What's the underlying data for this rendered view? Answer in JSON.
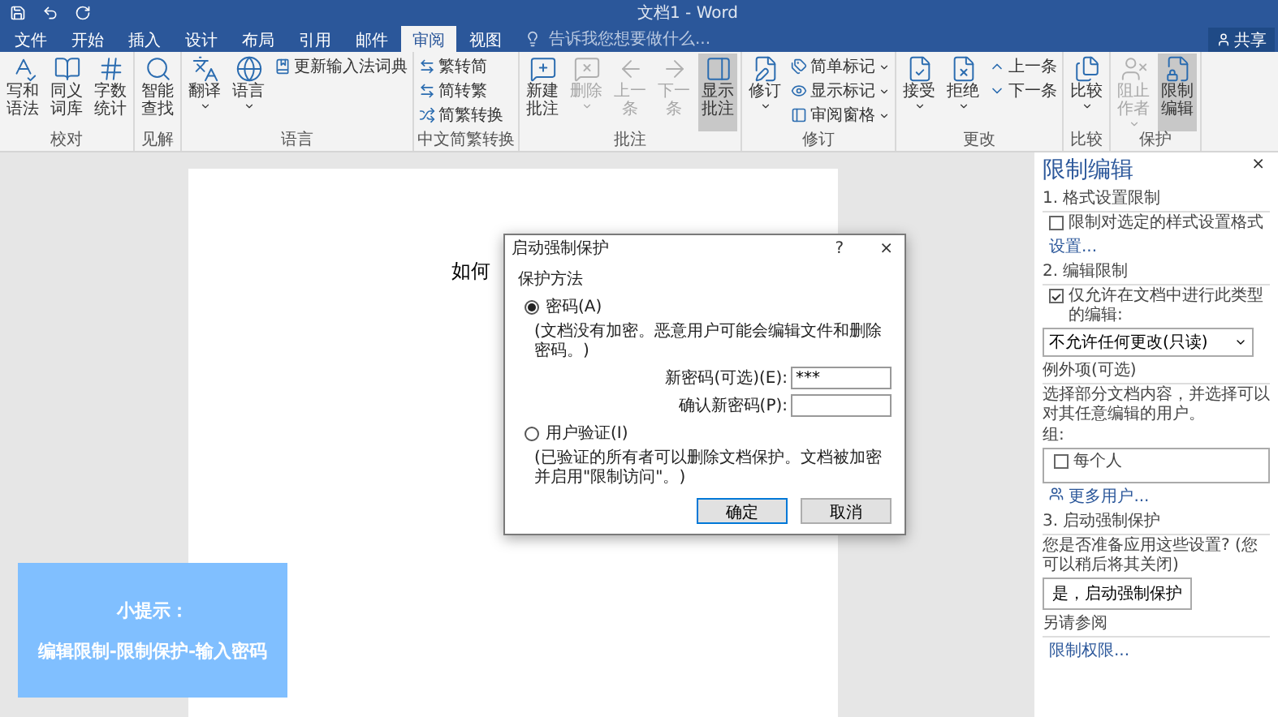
{
  "window": {
    "title": "文档1 - Word",
    "share": "共享"
  },
  "tabs": [
    {
      "label": "文件",
      "selected": false
    },
    {
      "label": "开始",
      "selected": false
    },
    {
      "label": "插入",
      "selected": false
    },
    {
      "label": "设计",
      "selected": false
    },
    {
      "label": "布局",
      "selected": false
    },
    {
      "label": "引用",
      "selected": false
    },
    {
      "label": "邮件",
      "selected": false
    },
    {
      "label": "审阅",
      "selected": true
    },
    {
      "label": "视图",
      "selected": false
    }
  ],
  "tell_me": {
    "placeholder": "告诉我您想要做什么..."
  },
  "ribbon": {
    "groups": [
      {
        "label": "校对",
        "items": [
          {
            "kind": "large",
            "label": "写和语法",
            "disabled": false,
            "on": false,
            "dropdown": false
          },
          {
            "kind": "large",
            "label": "同义词库",
            "disabled": false,
            "on": false,
            "dropdown": false
          },
          {
            "kind": "large",
            "label": "字数统计",
            "disabled": false,
            "on": false,
            "dropdown": false
          }
        ]
      },
      {
        "label": "见解",
        "items": [
          {
            "kind": "large",
            "label": "智能查找",
            "disabled": false,
            "on": false,
            "dropdown": false
          }
        ]
      },
      {
        "label": "语言",
        "items": [
          {
            "kind": "large",
            "label": "翻译",
            "disabled": false,
            "on": false,
            "dropdown": true
          },
          {
            "kind": "large",
            "label": "语言",
            "disabled": false,
            "on": false,
            "dropdown": true
          },
          {
            "kind": "small",
            "label": "更新输入法词典",
            "disabled": false,
            "on": false,
            "dropdown": false
          }
        ]
      },
      {
        "label": "中文简繁转换",
        "items": [
          {
            "kind": "small",
            "label": "繁转简",
            "disabled": false,
            "on": false,
            "dropdown": false
          },
          {
            "kind": "small",
            "label": "简转繁",
            "disabled": false,
            "on": false,
            "dropdown": false
          },
          {
            "kind": "small",
            "label": "简繁转换",
            "disabled": false,
            "on": false,
            "dropdown": false
          }
        ]
      },
      {
        "label": "批注",
        "items": [
          {
            "kind": "large",
            "label": "新建批注",
            "disabled": false,
            "on": false,
            "dropdown": false
          },
          {
            "kind": "large",
            "label": "删除",
            "disabled": true,
            "on": false,
            "dropdown": true
          },
          {
            "kind": "large",
            "label": "上一条",
            "disabled": true,
            "on": false,
            "dropdown": false
          },
          {
            "kind": "large",
            "label": "下一条",
            "disabled": true,
            "on": false,
            "dropdown": false
          },
          {
            "kind": "large",
            "label": "显示批注",
            "disabled": false,
            "on": true,
            "dropdown": false
          }
        ]
      },
      {
        "label": "修订",
        "items": [
          {
            "kind": "large",
            "label": "修订",
            "disabled": false,
            "on": false,
            "dropdown": true
          },
          {
            "kind": "small",
            "label": "简单标记",
            "disabled": false,
            "on": false,
            "dropdown": true
          },
          {
            "kind": "small",
            "label": "显示标记",
            "disabled": false,
            "on": false,
            "dropdown": true
          },
          {
            "kind": "small",
            "label": "审阅窗格",
            "disabled": false,
            "on": false,
            "dropdown": true
          }
        ]
      },
      {
        "label": "更改",
        "items": [
          {
            "kind": "large",
            "label": "接受",
            "disabled": false,
            "on": false,
            "dropdown": true
          },
          {
            "kind": "large",
            "label": "拒绝",
            "disabled": false,
            "on": false,
            "dropdown": true
          },
          {
            "kind": "small",
            "label": "上一条",
            "disabled": false,
            "on": false,
            "dropdown": false
          },
          {
            "kind": "small",
            "label": "下一条",
            "disabled": false,
            "on": false,
            "dropdown": false
          }
        ]
      },
      {
        "label": "比较",
        "items": [
          {
            "kind": "large",
            "label": "比较",
            "disabled": false,
            "on": false,
            "dropdown": true
          }
        ]
      },
      {
        "label": "保护",
        "items": [
          {
            "kind": "large",
            "label": "阻止作者",
            "disabled": true,
            "on": false,
            "dropdown": true
          },
          {
            "kind": "large",
            "label": "限制编辑",
            "disabled": false,
            "on": true,
            "dropdown": false
          }
        ]
      }
    ]
  },
  "document": {
    "text": "如何"
  },
  "dialog": {
    "title": "启动强制保护",
    "help": "?",
    "close": "×",
    "section": "保护方法",
    "options": [
      {
        "label": "密码(A)",
        "selected": true,
        "note": "(文档没有加密。恶意用户可能会编辑文件和删除密码。)",
        "fields": [
          {
            "label": "新密码(可选)(E):",
            "value": "***"
          },
          {
            "label": "确认新密码(P):"
          }
        ]
      },
      {
        "label": "用户验证(I)",
        "selected": false,
        "note": "(已验证的所有者可以删除文档保护。文档被加密并启用\"限制访问\"。)"
      }
    ],
    "buttons": [
      "确定",
      "取消"
    ]
  },
  "pane": {
    "title": "限制编辑",
    "close": "×",
    "section1": {
      "heading": "1. 格式设置限制",
      "checkbox": {
        "label": "限制对选定的样式设置格式",
        "checked": false
      },
      "link": "设置..."
    },
    "section2": {
      "heading": "2. 编辑限制",
      "checkbox": {
        "label": "仅允许在文档中进行此类型的编辑:",
        "checked": true
      },
      "select": "不允许任何更改(只读)",
      "exceptions_heading": "例外项(可选)",
      "exceptions_text": "选择部分文档内容，并选择可以对其任意编辑的用户。",
      "group_label": "组:",
      "users": [
        {
          "label": "每个人",
          "checked": false
        }
      ],
      "more_users": "更多用户..."
    },
    "section3": {
      "heading": "3. 启动强制保护",
      "text": "您是否准备应用这些设置? (您可以稍后将其关闭)",
      "button": "是，启动强制保护"
    },
    "see_also": {
      "heading": "另请参阅",
      "link": "限制权限..."
    }
  },
  "tip": {
    "title": "小提示：",
    "text": "编辑限制-限制保护-输入密码"
  }
}
